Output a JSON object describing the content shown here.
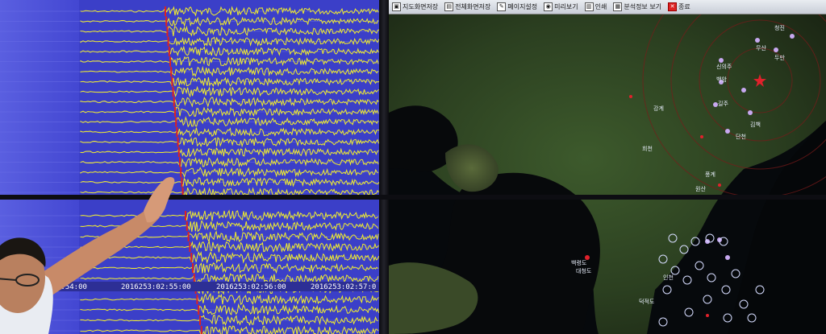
{
  "seismograph": {
    "time_labels": [
      "2:54:00",
      "2016253:02:55:00",
      "2016253:02:56:00",
      "2016253:02:57:0"
    ]
  },
  "map": {
    "toolbar": [
      {
        "icon": "map-reset-icon",
        "label": "지도화면저장"
      },
      {
        "icon": "save-screen-icon",
        "label": "전체화면저장"
      },
      {
        "icon": "page-setup-icon",
        "label": "페이지설정"
      },
      {
        "icon": "preview-icon",
        "label": "미리보기"
      },
      {
        "icon": "print-icon",
        "label": "인쇄"
      },
      {
        "icon": "analysis-info-icon",
        "label": "분석정보 보기"
      },
      {
        "icon": "close-icon",
        "label": "종료"
      }
    ],
    "cities": [
      {
        "name": "신의주"
      },
      {
        "name": "무산"
      },
      {
        "name": "두만"
      },
      {
        "name": "백암"
      },
      {
        "name": "길주"
      },
      {
        "name": "김책"
      },
      {
        "name": "단천"
      },
      {
        "name": "강계"
      },
      {
        "name": "희천"
      },
      {
        "name": "원산"
      },
      {
        "name": "백령도"
      },
      {
        "name": "대청도"
      },
      {
        "name": "인천"
      },
      {
        "name": "덕적도"
      },
      {
        "name": "청진"
      },
      {
        "name": "풍계"
      }
    ],
    "epicenter_marker_color": "#e0212b"
  },
  "colors": {
    "screen_blue": "#3b3fc8",
    "trace_yellow": "#f2ee2a",
    "pick_red": "#e02020"
  }
}
